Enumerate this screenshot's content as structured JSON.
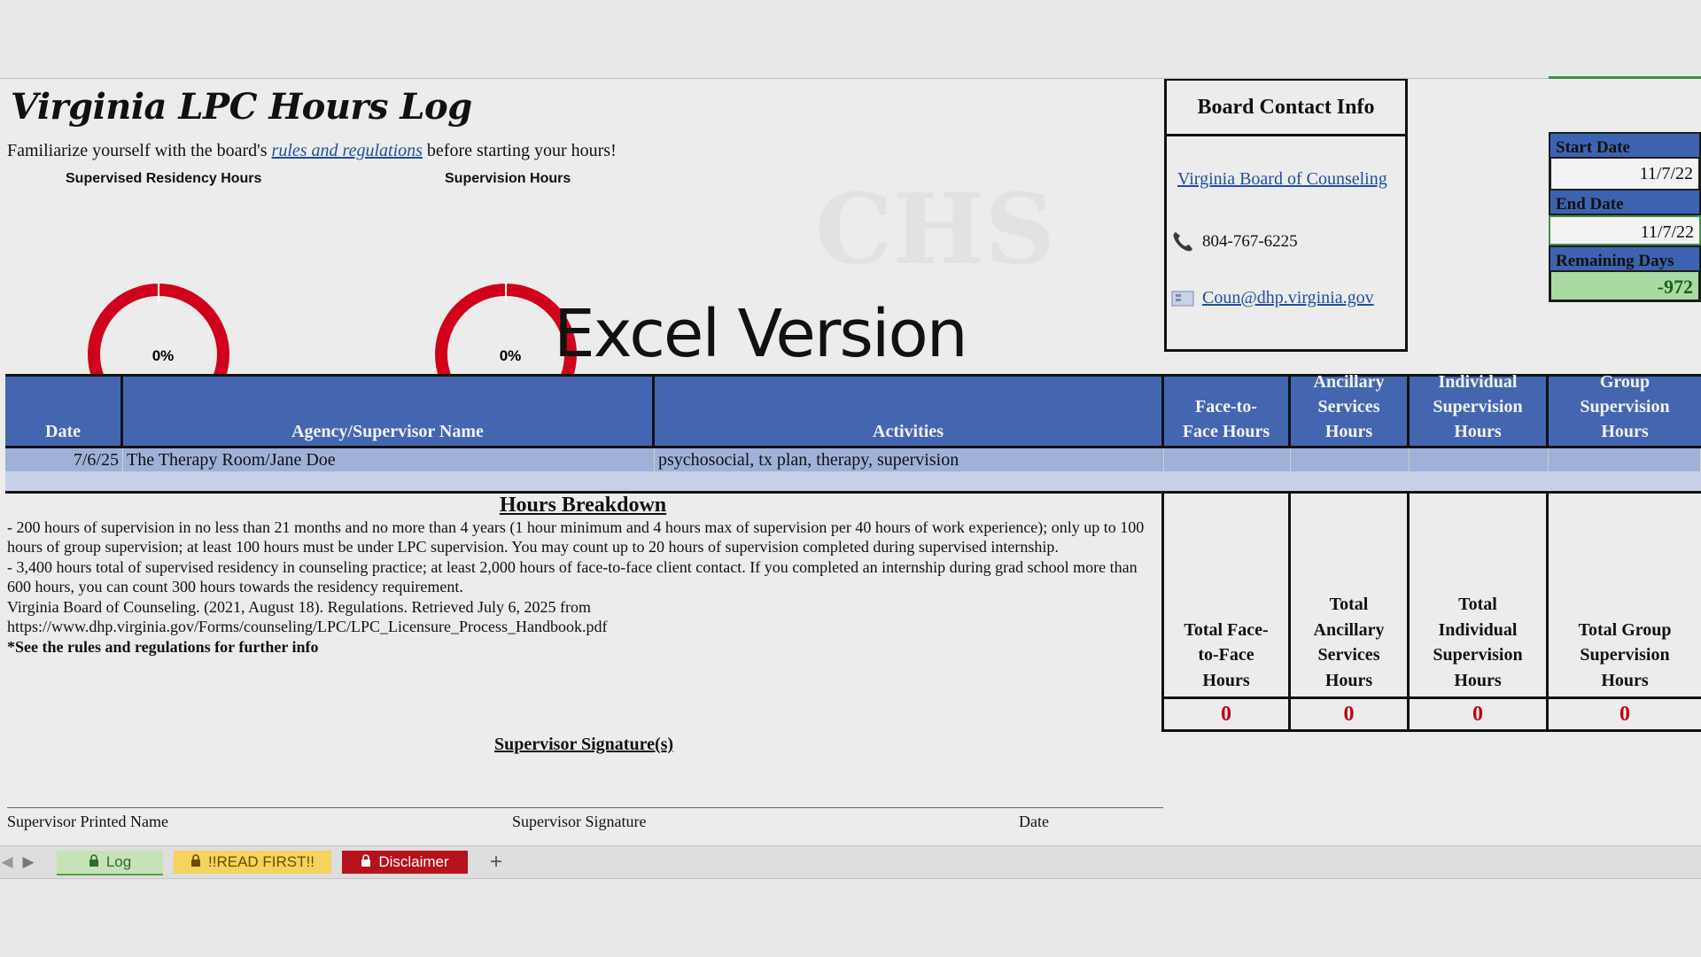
{
  "header": {
    "title": "Virginia LPC Hours Log",
    "intro_before": "Familiarize yourself with the board's ",
    "intro_link": "rules and regulations",
    "intro_after": " before starting your hours!"
  },
  "gauges": [
    {
      "label": "Supervised Residency Hours",
      "percent_text": "0%",
      "progress": 0
    },
    {
      "label": "Supervision Hours",
      "percent_text": "0%",
      "progress": 0
    }
  ],
  "overlay_text": "Excel Version",
  "contact": {
    "heading": "Board Contact Info",
    "board_link": "Virginia Board of Counseling",
    "phone": "804-767-6225",
    "email": "Coun@dhp.virginia.gov",
    "phone_icon": "phone-icon",
    "email_icon": "email-icon"
  },
  "dates": {
    "start_label": "Start Date",
    "start_value": "11/7/22",
    "end_label": "End Date",
    "end_value": "11/7/22",
    "remaining_label": "Remaining Days",
    "remaining_value": "-972"
  },
  "table": {
    "headers": [
      "Date",
      "Agency/Supervisor Name",
      "Activities",
      "Face-to-Face Hours",
      "Ancillary Services Hours",
      "Individual Supervision Hours",
      "Group Supervision Hours"
    ],
    "rows": [
      {
        "date": "7/6/25",
        "agency": "The Therapy Room/Jane Doe",
        "activities": "psychosocial, tx plan, therapy, supervision",
        "f2f": "",
        "ancillary": "",
        "individual": "",
        "group": ""
      }
    ]
  },
  "breakdown": {
    "heading": "Hours Breakdown",
    "line1": "- 200 hours of supervision in no less than 21 months and no more than 4 years (1 hour minimum and 4 hours max of supervision per 40 hours of work experience); only up to 100 hours of group supervision; at least 100 hours must be under LPC supervision. You may count up to 20 hours of supervision completed during supervised internship.",
    "line2": "- 3,400 hours total of supervised residency in counseling practice; at least 2,000 hours of face-to-face client contact. If you completed an internship during grad school more than 600 hours, you can count 300 hours towards the residency requirement.",
    "line3": "Virginia Board of Counseling. (2021, August 18). Regulations. Retrieved July 6, 2025 from",
    "line4": "https://www.dhp.virginia.gov/Forms/counseling/LPC/LPC_Licensure_Process_Handbook.pdf",
    "note": "*See the rules and regulations for further info"
  },
  "totals": {
    "labels": [
      "Total Face-to-Face Hours",
      "Total Ancillary Services Hours",
      "Total Individual Supervision Hours",
      "Total Group Supervision Hours"
    ],
    "values": [
      "0",
      "0",
      "0",
      "0"
    ]
  },
  "signature": {
    "title": "Supervisor Signature(s)",
    "printed_name": "Supervisor Printed Name",
    "signature": "Supervisor Signature",
    "date": "Date"
  },
  "tabs": [
    {
      "label": "Log",
      "color": "#c6e2b6",
      "text_color": "#2e6b2e"
    },
    {
      "label": "!!READ FIRST!!",
      "color": "#f4d35e",
      "text_color": "#6b4b00"
    },
    {
      "label": "Disclaimer",
      "color": "#b5121b",
      "text_color": "#ffffff"
    }
  ],
  "colors": {
    "header_blue": "#4466b1",
    "row_blue": "#9fb1d8",
    "gauge_red": "#d0021b",
    "total_red": "#c00015",
    "remaining_green": "#a7dba0"
  }
}
